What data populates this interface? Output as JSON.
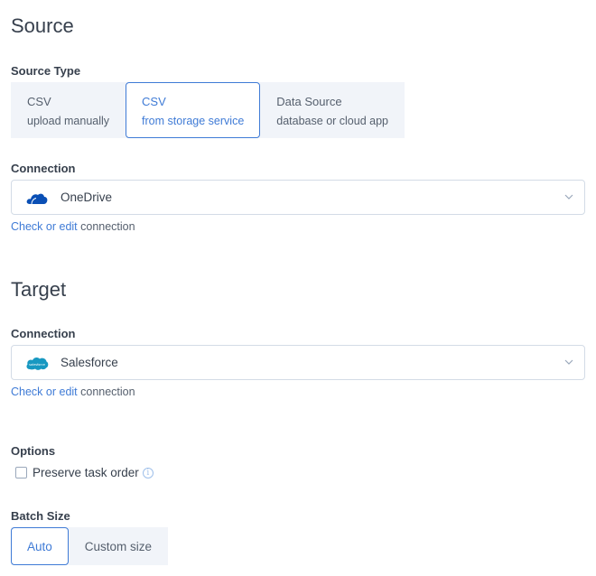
{
  "source": {
    "title": "Source",
    "source_type_label": "Source Type",
    "source_types": [
      {
        "title": "CSV",
        "subtitle": "upload manually",
        "selected": false
      },
      {
        "title": "CSV",
        "subtitle": "from storage service",
        "selected": true
      },
      {
        "title": "Data Source",
        "subtitle": "database or cloud app",
        "selected": false
      }
    ],
    "connection_label": "Connection",
    "connection_value": "OneDrive",
    "connection_icon": "onedrive-cloud-icon",
    "check_link": "Check or edit",
    "check_rest": " connection"
  },
  "target": {
    "title": "Target",
    "connection_label": "Connection",
    "connection_value": "Salesforce",
    "connection_icon": "salesforce-cloud-icon",
    "check_link": "Check or edit",
    "check_rest": " connection"
  },
  "options": {
    "label": "Options",
    "preserve_task_order_label": "Preserve task order",
    "preserve_task_order_checked": false,
    "info_glyph": "i"
  },
  "batch_size": {
    "label": "Batch Size",
    "options": [
      {
        "label": "Auto",
        "selected": true
      },
      {
        "label": "Custom size",
        "selected": false
      }
    ]
  },
  "colors": {
    "accent": "#3f7bd6",
    "onedrive": "#0a4fb5",
    "salesforce": "#1798c1",
    "segment_bg": "#f1f4f9"
  }
}
